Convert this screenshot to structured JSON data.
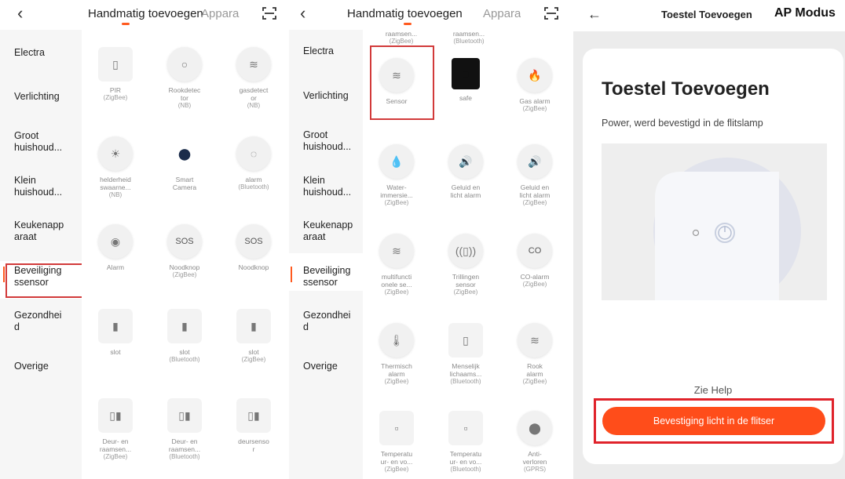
{
  "header": {
    "back_glyph": "‹",
    "tab_active": "Handmatig toevoegen",
    "tab_other": "Appara"
  },
  "sidebar": {
    "items": [
      {
        "label": "Electra"
      },
      {
        "label": "Verlichting"
      },
      {
        "label": "Groot\nhuishoud..."
      },
      {
        "label": "Klein\nhuishoud..."
      },
      {
        "label": "Keukenapp\naraat"
      },
      {
        "label": "Beveiliging\nssensor"
      },
      {
        "label": "Gezondhei\nd"
      },
      {
        "label": "Overige"
      }
    ]
  },
  "panel1_devices": [
    {
      "icon": "pir-sensor-icon",
      "glyph": "▯",
      "name": "PIR",
      "sub": "(ZigBee)"
    },
    {
      "icon": "smoke-detector-icon",
      "glyph": "○",
      "name": "Rookdetec\ntor",
      "sub": "(NB)"
    },
    {
      "icon": "gas-detector-icon",
      "glyph": "≋",
      "name": "gasdetect\nor",
      "sub": "(NB)"
    },
    {
      "icon": "brightness-sensor-icon",
      "glyph": "☀",
      "name": "helderheid\nswaarne...",
      "sub": "(NB)"
    },
    {
      "icon": "smart-camera-icon",
      "glyph": "●",
      "name": "Smart\nCamera",
      "sub": ""
    },
    {
      "icon": "alarm-icon",
      "glyph": "◌",
      "name": "alarm",
      "sub": "(Bluetooth)"
    },
    {
      "icon": "alarm-icon",
      "glyph": "◉",
      "name": "Alarm",
      "sub": ""
    },
    {
      "icon": "sos-button-icon",
      "glyph": "SOS",
      "name": "Noodknop",
      "sub": "(ZigBee)"
    },
    {
      "icon": "sos-button-icon",
      "glyph": "SOS",
      "name": "Noodknop",
      "sub": ""
    },
    {
      "icon": "door-lock-icon",
      "glyph": "▮",
      "name": "slot",
      "sub": ""
    },
    {
      "icon": "door-lock-icon",
      "glyph": "▮",
      "name": "slot",
      "sub": "(Bluetooth)"
    },
    {
      "icon": "door-lock-icon",
      "glyph": "▮",
      "name": "slot",
      "sub": "(ZigBee)"
    },
    {
      "icon": "door-sensor-icon",
      "glyph": "▯▮",
      "name": "Deur- en\nraamsen...",
      "sub": "(ZigBee)"
    },
    {
      "icon": "door-sensor-icon",
      "glyph": "▯▮",
      "name": "Deur- en\nraamsen...",
      "sub": "(Bluetooth)"
    },
    {
      "icon": "door-sensor-icon",
      "glyph": "▯▮",
      "name": "deursenso\nr",
      "sub": ""
    }
  ],
  "panel2_top_partial": [
    {
      "name": "raamsen...",
      "sub": "(ZigBee)"
    },
    {
      "name": "raamsen...",
      "sub": "(Bluetooth)"
    }
  ],
  "panel2_devices": [
    {
      "icon": "sensor-icon",
      "glyph": "≋",
      "name": "Sensor",
      "sub": ""
    },
    {
      "icon": "safe-icon",
      "glyph": "■",
      "name": "safe",
      "sub": ""
    },
    {
      "icon": "gas-alarm-icon",
      "glyph": "🔥",
      "name": "Gas alarm",
      "sub": "(ZigBee)"
    },
    {
      "icon": "water-drop-icon",
      "glyph": "💧",
      "name": "Water-\nimmersie...",
      "sub": "(ZigBee)"
    },
    {
      "icon": "sound-light-alarm-icon",
      "glyph": "🔊",
      "name": "Geluid en\nlicht alarm",
      "sub": ""
    },
    {
      "icon": "sound-light-alarm-icon",
      "glyph": "🔊",
      "name": "Geluid en\nlicht alarm",
      "sub": "(ZigBee)"
    },
    {
      "icon": "multifunction-sensor-icon",
      "glyph": "≋",
      "name": "multifuncti\nonele se...",
      "sub": "(ZigBee)"
    },
    {
      "icon": "vibration-sensor-icon",
      "glyph": "((▯))",
      "name": "Trillingen\nsensor",
      "sub": "(ZigBee)"
    },
    {
      "icon": "co-alarm-icon",
      "glyph": "CO",
      "name": "CO-alarm",
      "sub": "(ZigBee)"
    },
    {
      "icon": "thermometer-icon",
      "glyph": "🌡",
      "name": "Thermisch\nalarm",
      "sub": "(ZigBee)"
    },
    {
      "icon": "human-body-sensor-icon",
      "glyph": "▯",
      "name": "Menselijk\nlichaams...",
      "sub": "(Bluetooth)"
    },
    {
      "icon": "smoke-alarm-icon",
      "glyph": "≋",
      "name": "Rook\nalarm",
      "sub": "(ZigBee)"
    },
    {
      "icon": "temperature-sensor-icon",
      "glyph": "▫",
      "name": "Temperatu\nur- en vo...",
      "sub": "(ZigBee)"
    },
    {
      "icon": "temperature-sensor-icon",
      "glyph": "▫",
      "name": "Temperatu\nur- en vo...",
      "sub": "(Bluetooth)"
    },
    {
      "icon": "location-pin-icon",
      "glyph": "⬤",
      "name": "Anti-\nverloren",
      "sub": "(GPRS)"
    }
  ],
  "panel3": {
    "back_glyph": "←",
    "title": "Toestel Toevoegen",
    "mode": "AP Modus",
    "card_title": "Toestel Toevoegen",
    "card_subtitle": "Power, werd bevestigd in de flitslamp",
    "help_link": "Zie Help",
    "confirm_button": "Bevestiging licht in de flitser"
  },
  "colors": {
    "accent": "#ff5a1f",
    "button": "#ff4d1a",
    "highlight_box": "#d23a3a"
  }
}
